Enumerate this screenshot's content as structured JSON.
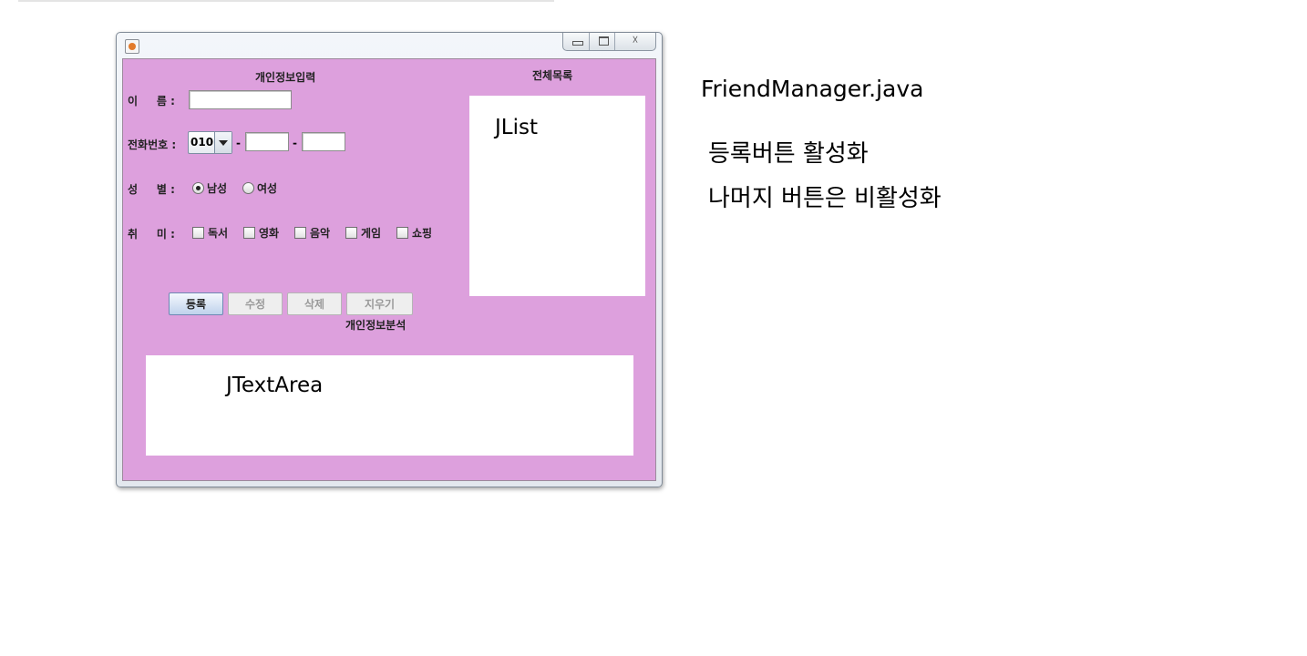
{
  "window": {
    "title": "",
    "controls": {
      "minimize_icon": "minimize-icon",
      "maximize_icon": "maximize-icon",
      "close_icon": "close-icon",
      "close_glyph": "☓"
    }
  },
  "form": {
    "section_title": "개인정보입력",
    "name_label": "이     름 :",
    "name_value": "",
    "phone_label": "전화번호 :",
    "phone_prefix": "010",
    "phone_dash": "-",
    "phone_middle": "",
    "phone_last": "",
    "gender_label": "성     별 :",
    "gender_options": [
      {
        "label": "남성",
        "selected": true
      },
      {
        "label": "여성",
        "selected": false
      }
    ],
    "hobby_label": "취     미 :",
    "hobbies": [
      {
        "label": "독서",
        "checked": false
      },
      {
        "label": "영화",
        "checked": false
      },
      {
        "label": "음악",
        "checked": false
      },
      {
        "label": "게임",
        "checked": false
      },
      {
        "label": "쇼핑",
        "checked": false
      }
    ]
  },
  "buttons": {
    "register": {
      "label": "등록",
      "enabled": true
    },
    "edit": {
      "label": "수정",
      "enabled": false
    },
    "delete": {
      "label": "삭제",
      "enabled": false
    },
    "clear": {
      "label": "지우기",
      "enabled": false
    }
  },
  "list_panel": {
    "title": "전체목록",
    "placeholder": "JList"
  },
  "analysis_panel": {
    "title": "개인정보분석",
    "placeholder": "JTextArea"
  },
  "notes": {
    "filename": "FriendManager.java",
    "line1": "등록버튼 활성화",
    "line2": "나머지 버튼은 비활성화"
  },
  "colors": {
    "panel_background": "#dda0dd",
    "enabled_button": "#bfd2ec",
    "disabled_button": "#eeeeee"
  }
}
